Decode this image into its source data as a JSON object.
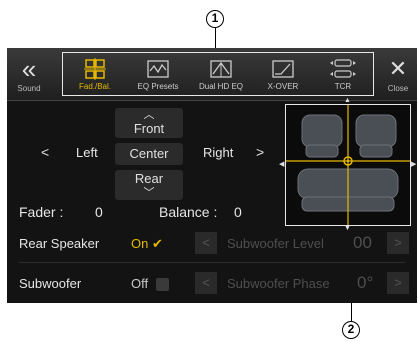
{
  "callouts": [
    "1",
    "2"
  ],
  "top_bar": {
    "back_label": "Sound",
    "close_label": "Close",
    "tabs": [
      {
        "label": "Fad./Bal.",
        "icon": "fader-balance-icon",
        "active": true
      },
      {
        "label": "EQ Presets",
        "icon": "eq-presets-icon",
        "active": false
      },
      {
        "label": "Dual HD EQ",
        "icon": "dual-hd-eq-icon",
        "active": false
      },
      {
        "label": "X-OVER",
        "icon": "x-over-icon",
        "active": false
      },
      {
        "label": "TCR",
        "icon": "tcr-icon",
        "active": false
      }
    ]
  },
  "balance_controls": {
    "front_label": "Front",
    "rear_label": "Rear",
    "left_label": "Left",
    "center_label": "Center",
    "right_label": "Right"
  },
  "readouts": {
    "fader_label": "Fader :",
    "fader_value": "0",
    "balance_label": "Balance :",
    "balance_value": "0"
  },
  "settings": {
    "rear_speaker_label": "Rear Speaker",
    "rear_speaker_state": "On",
    "subwoofer_level_label": "Subwoofer Level",
    "subwoofer_level_value": "00",
    "subwoofer_label": "Subwoofer",
    "subwoofer_state": "Off",
    "subwoofer_phase_label": "Subwoofer Phase",
    "subwoofer_phase_value": "0°"
  },
  "colors": {
    "accent": "#e5b800",
    "background": "#131313"
  }
}
